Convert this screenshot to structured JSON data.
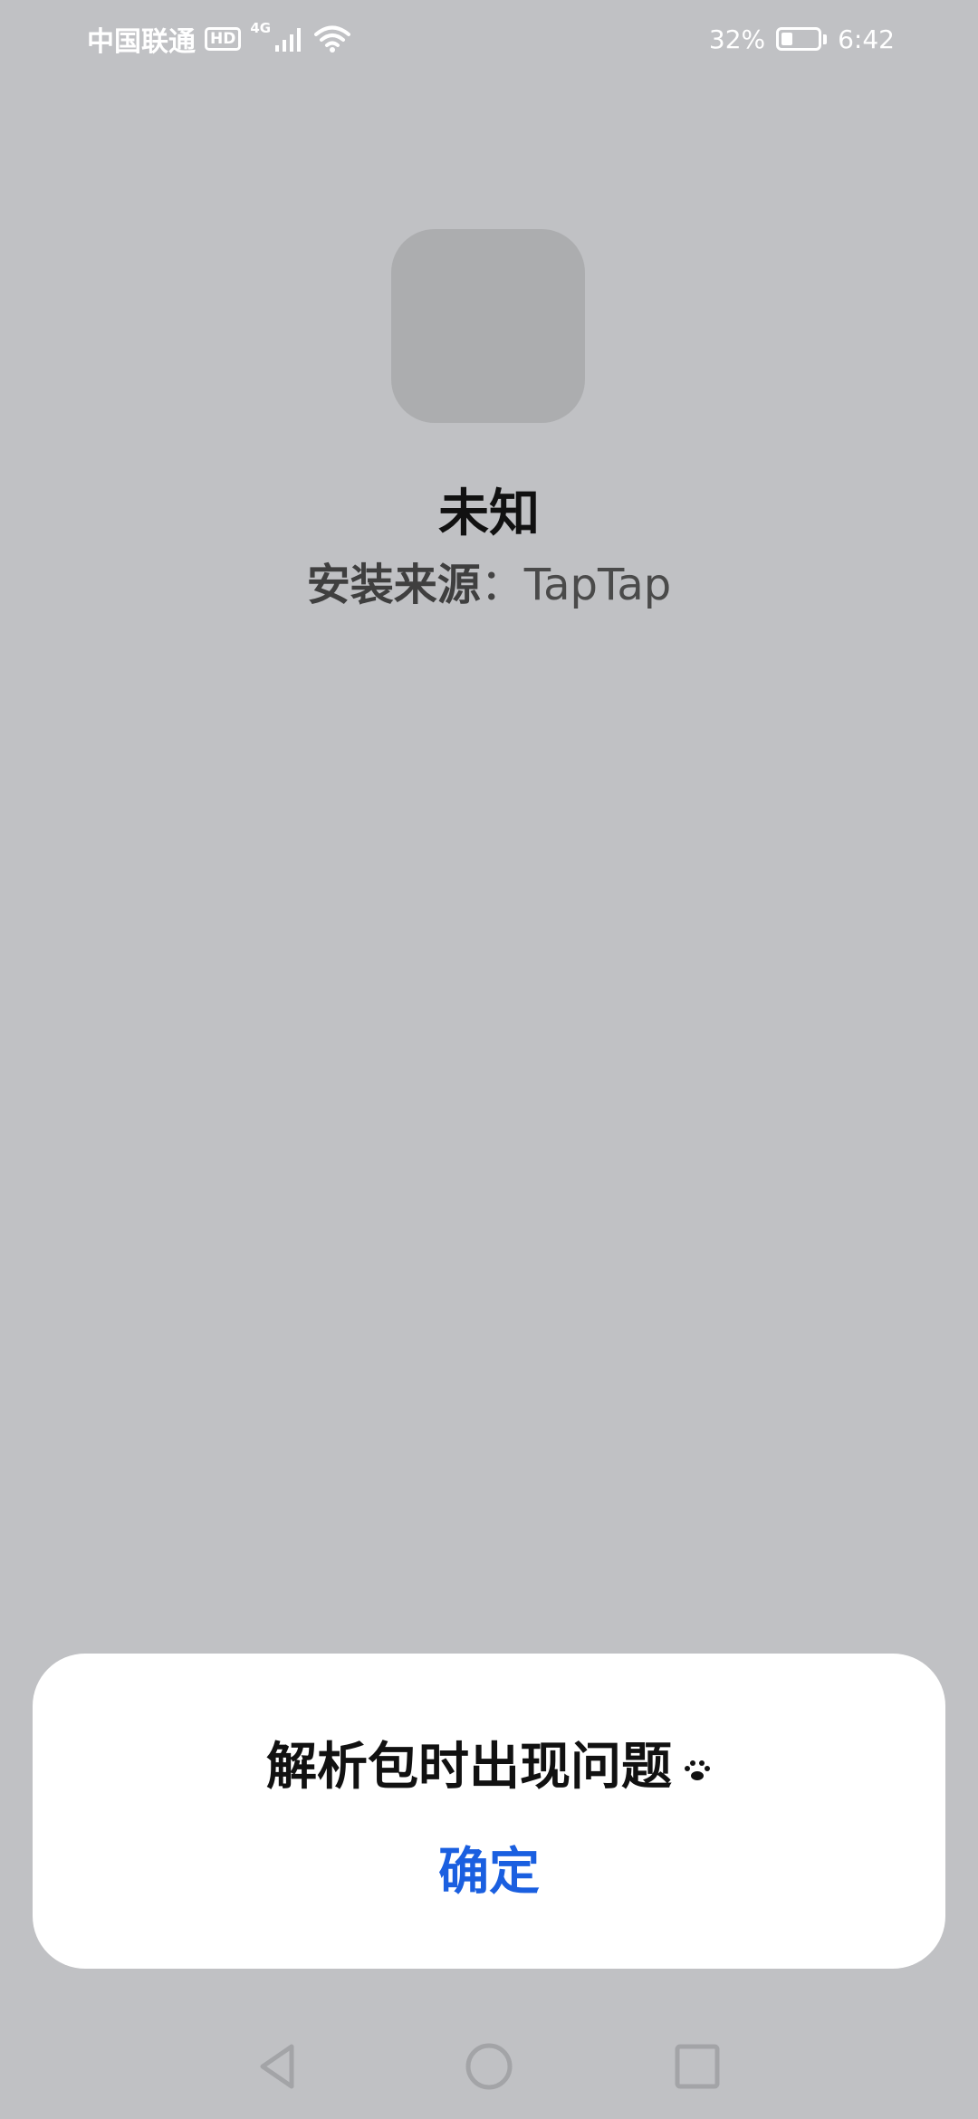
{
  "status_bar": {
    "carrier": "中国联通",
    "hd_badge": "HD",
    "network_type": "4G",
    "battery_percent_text": "32%",
    "battery_level": 0.32,
    "time": "6:42",
    "icons": [
      "hd-badge",
      "signal-icon",
      "wifi-icon",
      "battery-icon"
    ]
  },
  "app": {
    "name": "未知",
    "source_label": "安装来源",
    "source_separator": "：",
    "source_value": "TapTap"
  },
  "dialog": {
    "message": "解析包时出现问题",
    "confirm_label": "确定"
  },
  "nav_bar": {
    "icons": [
      "back-icon",
      "home-icon",
      "recents-icon"
    ]
  },
  "colors": {
    "background": "#c0c1c4",
    "accent": "#1a5fe0",
    "icon_placeholder": "#acadaf"
  }
}
